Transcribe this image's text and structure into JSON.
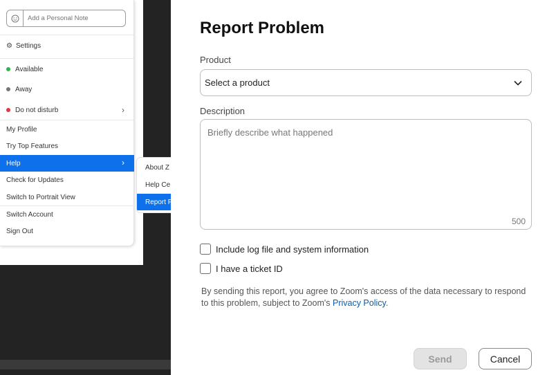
{
  "left_menu": {
    "note_placeholder": "Add a Personal Note",
    "settings": "Settings",
    "status_available": "Available",
    "status_away": "Away",
    "status_dnd": "Do not disturb",
    "my_profile": "My Profile",
    "try_top_features": "Try Top Features",
    "help": "Help",
    "check_updates": "Check for Updates",
    "portrait_view": "Switch to Portrait View",
    "switch_account": "Switch Account",
    "sign_out": "Sign Out",
    "colors": {
      "available": "#2fb64b",
      "away": "#777777",
      "dnd": "#e5363b",
      "accent": "#0e71eb"
    }
  },
  "help_submenu": {
    "about": "About Z",
    "help_center": "Help Ce",
    "report": "Report P"
  },
  "dialog": {
    "title": "Report Problem",
    "product_label": "Product",
    "product_value": "Select a product",
    "description_label": "Description",
    "description_placeholder": "Briefly describe what happened",
    "char_limit": "500",
    "include_log_label": "Include log file and system information",
    "ticket_label": "I have a ticket ID",
    "disclaimer_text": "By sending this report, you agree to Zoom's access of the data necessary to respond to this problem, subject to Zoom's",
    "privacy_link": "Privacy Policy",
    "disclaimer_end": ".",
    "send_label": "Send",
    "cancel_label": "Cancel"
  }
}
